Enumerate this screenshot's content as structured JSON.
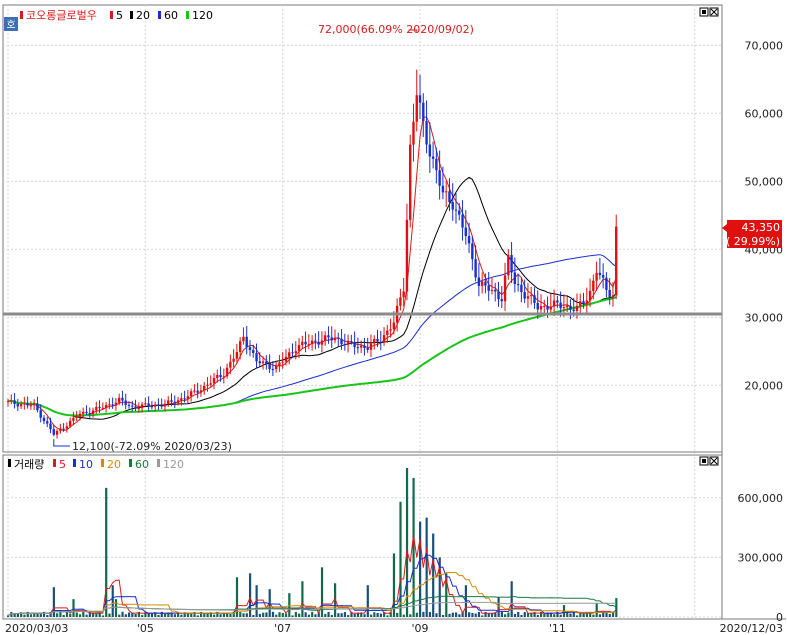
{
  "title": "코오롱글로벌우",
  "top_button": "호",
  "price_legend": [
    {
      "label": "5",
      "color": "#d81b1b"
    },
    {
      "label": "20",
      "color": "#000000"
    },
    {
      "label": "60",
      "color": "#1a2fcf"
    },
    {
      "label": "120",
      "color": "#19c419"
    }
  ],
  "volume_title": "거래량",
  "volume_legend": [
    {
      "label": "5",
      "color": "#d81b1b"
    },
    {
      "label": "10",
      "color": "#1a2fcf"
    },
    {
      "label": "20",
      "color": "#d98a00"
    },
    {
      "label": "60",
      "color": "#137a3a"
    },
    {
      "label": "120",
      "color": "#999999"
    }
  ],
  "high_annotation": "72,000(66.09% 2020/09/02)",
  "low_annotation": "12,100(-72.09% 2020/03/23)",
  "current_price": "43,350",
  "current_change": "( 29.99%)",
  "colors": {
    "up": "#e01010",
    "down": "#1a2fcf",
    "ref_line": "#8a8a8a",
    "price_box": "#e01010"
  },
  "chart_data": [
    {
      "type": "candlestick",
      "title": "코오롱글로벌우",
      "y_ticks": [
        "70,000",
        "60,000",
        "50,000",
        "40,000",
        "30,000",
        "20,000"
      ],
      "ylim": [
        10500,
        75500
      ],
      "reference_line": 30500,
      "x_ticks": [
        "2020/03/03",
        "'05",
        "'07",
        "'09",
        "'11",
        "2020/12/03"
      ],
      "x_tick_index": [
        0,
        42,
        84,
        126,
        168,
        210
      ],
      "high": {
        "value": 72000,
        "date": "2020/09/02"
      },
      "low": {
        "value": 12100,
        "date": "2020/03/23"
      },
      "last_close": 43350,
      "anchors": [
        [
          0,
          17500
        ],
        [
          8,
          17000
        ],
        [
          14,
          12800
        ],
        [
          16,
          13500
        ],
        [
          22,
          15800
        ],
        [
          26,
          16300
        ],
        [
          30,
          17000
        ],
        [
          34,
          17800
        ],
        [
          38,
          16800
        ],
        [
          42,
          17000
        ],
        [
          48,
          17200
        ],
        [
          54,
          18200
        ],
        [
          60,
          19800
        ],
        [
          66,
          21800
        ],
        [
          70,
          24800
        ],
        [
          72,
          27200
        ],
        [
          76,
          23500
        ],
        [
          82,
          22600
        ],
        [
          88,
          25600
        ],
        [
          94,
          26500
        ],
        [
          100,
          27000
        ],
        [
          104,
          26000
        ],
        [
          110,
          25600
        ],
        [
          114,
          26800
        ],
        [
          118,
          29200
        ],
        [
          121,
          34500
        ],
        [
          123,
          55000
        ],
        [
          125,
          63000
        ],
        [
          127,
          58000
        ],
        [
          130,
          53000
        ],
        [
          133,
          48000
        ],
        [
          136,
          47000
        ],
        [
          140,
          42000
        ],
        [
          144,
          35000
        ],
        [
          148,
          33800
        ],
        [
          151,
          33000
        ],
        [
          153,
          38500
        ],
        [
          155,
          35000
        ],
        [
          158,
          33500
        ],
        [
          162,
          31500
        ],
        [
          166,
          31800
        ],
        [
          170,
          31700
        ],
        [
          174,
          31200
        ],
        [
          176,
          32200
        ],
        [
          178,
          33800
        ],
        [
          180,
          37000
        ],
        [
          183,
          34000
        ],
        [
          185,
          33400
        ],
        [
          186,
          43350
        ]
      ]
    },
    {
      "type": "bar",
      "title": "거래량",
      "y_ticks": [
        "600,000",
        "300,000",
        "0"
      ],
      "ylim": [
        0,
        750000
      ],
      "spikes": [
        [
          14,
          150000
        ],
        [
          20,
          90000
        ],
        [
          30,
          650000
        ],
        [
          32,
          160000
        ],
        [
          33,
          90000
        ],
        [
          70,
          200000
        ],
        [
          74,
          220000
        ],
        [
          76,
          160000
        ],
        [
          80,
          140000
        ],
        [
          86,
          120000
        ],
        [
          90,
          180000
        ],
        [
          96,
          250000
        ],
        [
          100,
          170000
        ],
        [
          110,
          160000
        ],
        [
          118,
          320000
        ],
        [
          120,
          580000
        ],
        [
          122,
          750000
        ],
        [
          124,
          700000
        ],
        [
          126,
          480000
        ],
        [
          128,
          500000
        ],
        [
          130,
          420000
        ],
        [
          132,
          300000
        ],
        [
          134,
          220000
        ],
        [
          140,
          160000
        ],
        [
          150,
          100000
        ],
        [
          154,
          180000
        ],
        [
          170,
          60000
        ],
        [
          180,
          70000
        ],
        [
          186,
          95000
        ]
      ]
    }
  ]
}
